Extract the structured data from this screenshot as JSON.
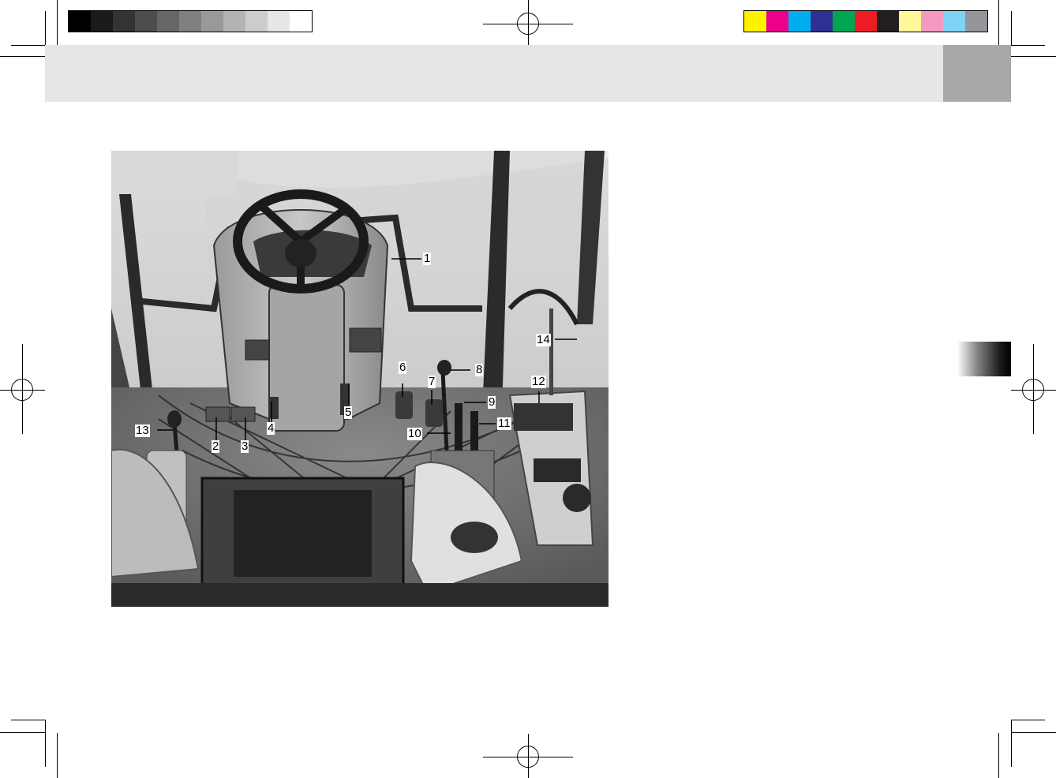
{
  "print_marks": {
    "gray_swatches": [
      "#000000",
      "#1a1a1a",
      "#333333",
      "#4d4d4d",
      "#666666",
      "#808080",
      "#999999",
      "#b3b3b3",
      "#cccccc",
      "#e6e6e6",
      "#ffffff"
    ],
    "color_swatches": [
      "#fff200",
      "#ec008c",
      "#00aeef",
      "#2e3192",
      "#00a651",
      "#ed1c24",
      "#231f20",
      "#fff799",
      "#f49ac1",
      "#7fd3f7",
      "#939598"
    ]
  },
  "colors": {
    "header_band": "#e6e6e6",
    "header_tab": "#a8a8a8",
    "figure_background": "#9a9a9a"
  },
  "figure": {
    "callouts": [
      "1",
      "2",
      "3",
      "4",
      "5",
      "6",
      "7",
      "8",
      "9",
      "10",
      "11",
      "12",
      "13",
      "14"
    ]
  }
}
